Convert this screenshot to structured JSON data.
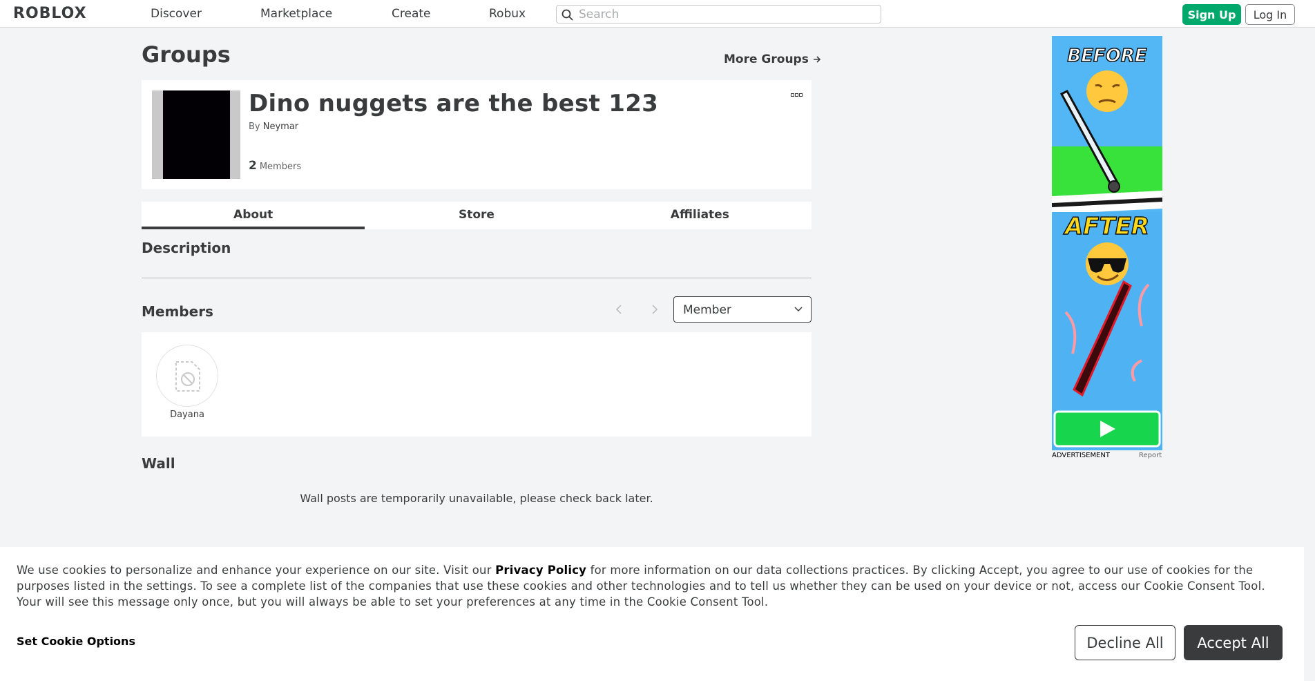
{
  "nav": {
    "logo": "ROBLOX",
    "links": [
      "Discover",
      "Marketplace",
      "Create",
      "Robux"
    ],
    "search_placeholder": "Search",
    "signup_label": "Sign Up",
    "login_label": "Log In"
  },
  "page": {
    "title": "Groups",
    "more_groups": "More Groups"
  },
  "group": {
    "name": "Dino nuggets are the best 123",
    "by_label": "By",
    "owner": "Neymar",
    "member_count": "2",
    "members_label": "Members"
  },
  "tabs": [
    "About",
    "Store",
    "Affiliates"
  ],
  "sections": {
    "description": "Description",
    "members": "Members",
    "wall": "Wall"
  },
  "members": {
    "role_selected": "Member",
    "list": [
      {
        "name": "Dayana"
      }
    ]
  },
  "wall": {
    "message": "Wall posts are temporarily unavailable, please check back later."
  },
  "ad": {
    "top_text": "BEFORE",
    "bottom_text": "AFTER",
    "top_emoji": "😔",
    "bottom_emoji": "😎",
    "label": "ADVERTISEMENT",
    "report": "Report"
  },
  "cookie": {
    "text_before": "We use cookies to personalize and enhance your experience on our site. Visit our ",
    "privacy_link": "Privacy Policy",
    "text_after": " for more information on our data collections practices. By clicking Accept, you agree to our use of cookies for the purposes listed in the settings. To see a complete list of the companies that use these cookies and other technologies and to tell us whether they can be used on your device or not, access our Cookie Consent Tool. Your will see this message only once, but you will always be able to set your preferences at any time in the Cookie Consent Tool.",
    "options": "Set Cookie Options",
    "decline": "Decline All",
    "accept": "Accept All"
  },
  "colors": {
    "signup_green": "#00a86b",
    "accept_dark": "#393b3d",
    "page_bg": "#f2f4f5"
  }
}
